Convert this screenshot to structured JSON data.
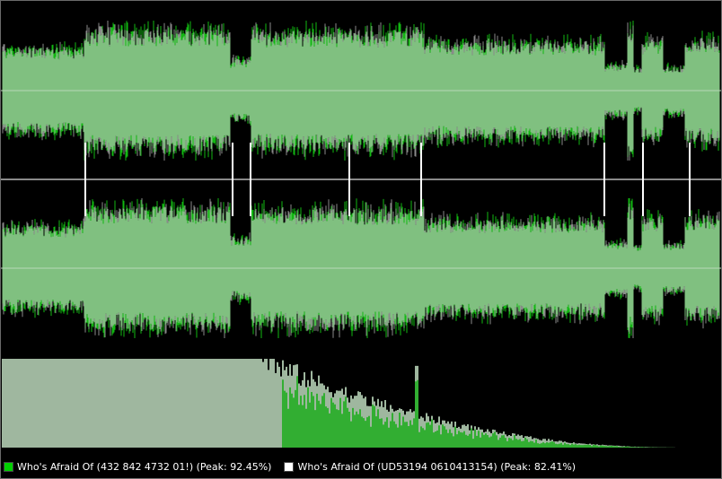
{
  "panel": {
    "name": "audio waveform comparison",
    "colors": {
      "background": "#000000",
      "waveform_fill": "#80c080",
      "track1_peak": "#12b812",
      "track2_peak": "#8a8a8a",
      "centerline": "#b8d8b8",
      "divider": "#8a8a8a",
      "marker": "#ffffff",
      "spectrum_light": "#d4f4d4",
      "spectrum_green": "#20c020"
    },
    "tracks": [
      {
        "label": "Who's Afraid Of (432 842 4732 01!) (Peak: 92.45%)",
        "swatch": "#00d000"
      },
      {
        "label": "Who's Afraid Of (UD53194 0610413154) (Peak: 82.41%)",
        "swatch": "#ffffff"
      }
    ],
    "markers": [
      {
        "channel": "left",
        "time_fraction": 0.117
      },
      {
        "channel": "left",
        "time_fraction": 0.322
      },
      {
        "channel": "left",
        "time_fraction": 0.347
      },
      {
        "channel": "left",
        "time_fraction": 0.484
      },
      {
        "channel": "left",
        "time_fraction": 0.584
      },
      {
        "channel": "left",
        "time_fraction": 0.838
      },
      {
        "channel": "left",
        "time_fraction": 0.891
      },
      {
        "channel": "left",
        "time_fraction": 0.956
      },
      {
        "channel": "right",
        "time_fraction": 0.117
      },
      {
        "channel": "right",
        "time_fraction": 0.322
      },
      {
        "channel": "right",
        "time_fraction": 0.347
      },
      {
        "channel": "right",
        "time_fraction": 0.484
      },
      {
        "channel": "right",
        "time_fraction": 0.584
      },
      {
        "channel": "right",
        "time_fraction": 0.838
      },
      {
        "channel": "right",
        "time_fraction": 0.891
      },
      {
        "channel": "right",
        "time_fraction": 0.956
      }
    ],
    "envelope": {
      "description_levels_fraction_of_full_scale": [
        {
          "from": 0.0,
          "to": 0.115,
          "level": 0.62
        },
        {
          "from": 0.115,
          "to": 0.318,
          "level": 0.88
        },
        {
          "from": 0.318,
          "to": 0.347,
          "level": 0.45
        },
        {
          "from": 0.347,
          "to": 0.588,
          "level": 0.86
        },
        {
          "from": 0.588,
          "to": 0.838,
          "level": 0.7
        },
        {
          "from": 0.838,
          "to": 0.87,
          "level": 0.38
        },
        {
          "from": 0.87,
          "to": 0.878,
          "level": 0.95
        },
        {
          "from": 0.878,
          "to": 0.89,
          "level": 0.32
        },
        {
          "from": 0.89,
          "to": 0.92,
          "level": 0.72
        },
        {
          "from": 0.92,
          "to": 0.95,
          "level": 0.35
        },
        {
          "from": 0.95,
          "to": 1.0,
          "level": 0.75
        }
      ]
    },
    "spectrum": {
      "flat_until_fraction": 0.36,
      "green_starts_fraction": 0.39,
      "spike_fraction": 0.578,
      "ends_fraction": 0.955
    }
  }
}
